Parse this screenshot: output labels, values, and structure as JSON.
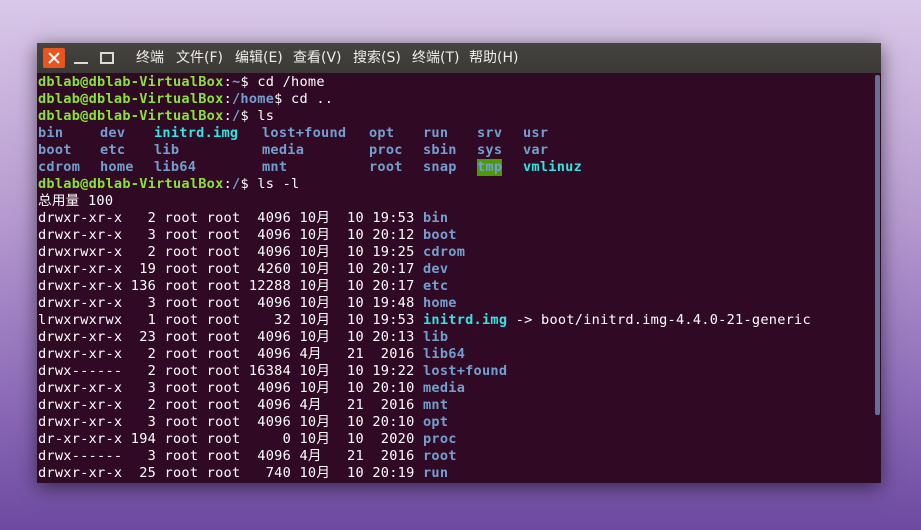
{
  "window": {
    "menu": [
      {
        "label": "终端"
      },
      {
        "label": "文件(F)"
      },
      {
        "label": "编辑(E)"
      },
      {
        "label": "查看(V)"
      },
      {
        "label": "搜索(S)"
      },
      {
        "label": "终端(T)"
      },
      {
        "label": "帮助(H)"
      }
    ]
  },
  "colors": {
    "terminal_bg": "#300a24",
    "prompt_user": "#8ae234",
    "prompt_path": "#729fcf",
    "directory": "#729fcf",
    "link": "#34e2e2",
    "sticky_bg": "#4e9a06",
    "close_button": "#e95420"
  },
  "terminal": {
    "prompt_user": "dblab@dblab-VirtualBox",
    "sessions": [
      {
        "path": "~",
        "command": "cd /home"
      },
      {
        "path": "/home",
        "command": "cd .."
      },
      {
        "path": "/",
        "command": "ls"
      },
      {
        "path": "/",
        "command": "ls -l"
      }
    ],
    "ls_rows": [
      [
        "bin",
        "dev",
        "initrd.img",
        "lost+found",
        "opt",
        "run",
        "srv",
        "usr"
      ],
      [
        "boot",
        "etc",
        "lib",
        "media",
        "proc",
        "sbin",
        "sys",
        "var"
      ],
      [
        "cdrom",
        "home",
        "lib64",
        "mnt",
        "root",
        "snap",
        "tmp",
        "vmlinuz"
      ]
    ],
    "total_line": "总用量 100",
    "listing": [
      {
        "meta": "drwxr-xr-x   2 root root  4096 10月  10 19:53",
        "name": "bin"
      },
      {
        "meta": "drwxr-xr-x   3 root root  4096 10月  10 20:12",
        "name": "boot"
      },
      {
        "meta": "drwxrwxr-x   2 root root  4096 10月  10 19:25",
        "name": "cdrom"
      },
      {
        "meta": "drwxr-xr-x  19 root root  4260 10月  10 20:17",
        "name": "dev"
      },
      {
        "meta": "drwxr-xr-x 136 root root 12288 10月  10 20:17",
        "name": "etc"
      },
      {
        "meta": "drwxr-xr-x   3 root root  4096 10月  10 19:48",
        "name": "home"
      },
      {
        "meta": "lrwxrwxrwx   1 root root    32 10月  10 19:53",
        "name": "initrd.img",
        "target": " -> boot/initrd.img-4.4.0-21-generic"
      },
      {
        "meta": "drwxr-xr-x  23 root root  4096 10月  10 20:13",
        "name": "lib"
      },
      {
        "meta": "drwxr-xr-x   2 root root  4096 4月   21  2016",
        "name": "lib64"
      },
      {
        "meta": "drwx------   2 root root 16384 10月  10 19:22",
        "name": "lost+found"
      },
      {
        "meta": "drwxr-xr-x   3 root root  4096 10月  10 20:10",
        "name": "media"
      },
      {
        "meta": "drwxr-xr-x   2 root root  4096 4月   21  2016",
        "name": "mnt"
      },
      {
        "meta": "drwxr-xr-x   3 root root  4096 10月  10 20:10",
        "name": "opt"
      },
      {
        "meta": "dr-xr-xr-x 194 root root     0 10月  10  2020",
        "name": "proc"
      },
      {
        "meta": "drwx------   3 root root  4096 4月   21  2016",
        "name": "root"
      },
      {
        "meta": "drwxr-xr-x  25 root root   740 10月  10 20:19",
        "name": "run"
      }
    ]
  }
}
